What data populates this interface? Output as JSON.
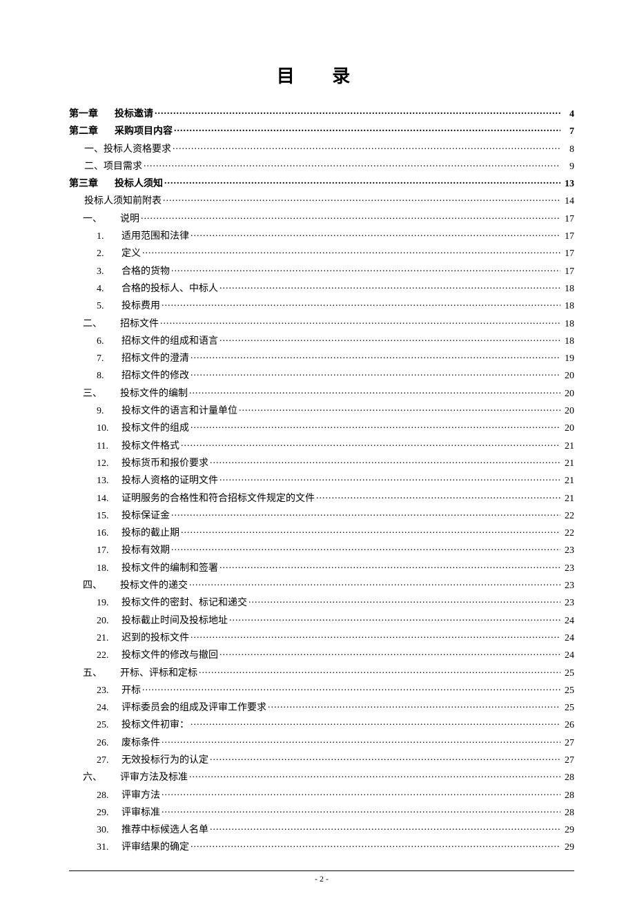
{
  "title": "目 录",
  "page_number_label": "- 2 -",
  "toc": [
    {
      "cls": "lv0 bold",
      "num": "第一章",
      "label": "投标邀请",
      "page": "4"
    },
    {
      "cls": "lv0 bold",
      "num": "第二章",
      "label": "采购项目内容",
      "page": "7"
    },
    {
      "cls": "lv1",
      "num": "",
      "label": "一、投标人资格要求",
      "page": "8"
    },
    {
      "cls": "lv1",
      "num": "",
      "label": "二、项目需求",
      "page": "9"
    },
    {
      "cls": "lv0 bold",
      "num": "第三章",
      "label": "投标人须知",
      "page": "13"
    },
    {
      "cls": "lv1",
      "num": "",
      "label": "投标人须知前附表",
      "page": "14"
    },
    {
      "cls": "lv1a",
      "num": "一、",
      "label": "说明",
      "page": "17"
    },
    {
      "cls": "lv2",
      "num": "1.",
      "label": "适用范围和法律",
      "page": "17"
    },
    {
      "cls": "lv2",
      "num": "2.",
      "label": "定义",
      "page": "17"
    },
    {
      "cls": "lv2",
      "num": "3.",
      "label": "合格的货物",
      "page": "17"
    },
    {
      "cls": "lv2",
      "num": "4.",
      "label": "合格的投标人、中标人",
      "page": "18"
    },
    {
      "cls": "lv2",
      "num": "5.",
      "label": "投标费用",
      "page": "18"
    },
    {
      "cls": "lv1a",
      "num": "二、",
      "label": "招标文件",
      "page": "18"
    },
    {
      "cls": "lv2",
      "num": "6.",
      "label": "招标文件的组成和语言",
      "page": "18"
    },
    {
      "cls": "lv2",
      "num": "7.",
      "label": "招标文件的澄清",
      "page": "19"
    },
    {
      "cls": "lv2",
      "num": "8.",
      "label": "招标文件的修改",
      "page": "20"
    },
    {
      "cls": "lv1a",
      "num": "三、",
      "label": "投标文件的编制",
      "page": "20"
    },
    {
      "cls": "lv2",
      "num": "9.",
      "label": "投标文件的语言和计量单位",
      "page": "20"
    },
    {
      "cls": "lv2",
      "num": "10.",
      "label": "  投标文件的组成",
      "page": "20"
    },
    {
      "cls": "lv2",
      "num": "11.",
      "label": "  投标文件格式",
      "page": "21"
    },
    {
      "cls": "lv2",
      "num": "12.",
      "label": "  投标货币和报价要求",
      "page": "21"
    },
    {
      "cls": "lv2",
      "num": "13.",
      "label": "  投标人资格的证明文件",
      "page": "21"
    },
    {
      "cls": "lv2",
      "num": "14.",
      "label": "  证明服务的合格性和符合招标文件规定的文件",
      "page": "21"
    },
    {
      "cls": "lv2",
      "num": "15.",
      "label": "  投标保证金",
      "page": "22"
    },
    {
      "cls": "lv2",
      "num": "16.",
      "label": "  投标的截止期",
      "page": "22"
    },
    {
      "cls": "lv2",
      "num": "17.",
      "label": "  投标有效期",
      "page": "23"
    },
    {
      "cls": "lv2",
      "num": "18.",
      "label": "  投标文件的编制和签署",
      "page": "23"
    },
    {
      "cls": "lv1a",
      "num": "四、",
      "label": "  投标文件的递交",
      "page": "23"
    },
    {
      "cls": "lv2",
      "num": "19.",
      "label": "  投标文件的密封、标记和递交",
      "page": "23"
    },
    {
      "cls": "lv2",
      "num": "20.",
      "label": "  投标截止时间及投标地址",
      "page": "24"
    },
    {
      "cls": "lv2",
      "num": "21.",
      "label": "  迟到的投标文件",
      "page": "24"
    },
    {
      "cls": "lv2",
      "num": "22.",
      "label": "  投标文件的修改与撤回",
      "page": "24"
    },
    {
      "cls": "lv1a",
      "num": "五、",
      "label": "开标、评标和定标",
      "page": "25"
    },
    {
      "cls": "lv2",
      "num": "23.",
      "label": "  开标",
      "page": "25"
    },
    {
      "cls": "lv2",
      "num": "24.",
      "label": "  评标委员会的组成及评审工作要求",
      "page": "25"
    },
    {
      "cls": "lv2",
      "num": "25.",
      "label": "  投标文件初审：",
      "page": "26"
    },
    {
      "cls": "lv2",
      "num": "26.",
      "label": "  废标条件",
      "page": "27"
    },
    {
      "cls": "lv2",
      "num": "27.",
      "label": "  无效投标行为的认定",
      "page": "27"
    },
    {
      "cls": "lv1a",
      "num": "六、",
      "label": "评审方法及标准",
      "page": "28"
    },
    {
      "cls": "lv2",
      "num": "28.",
      "label": "  评审方法",
      "page": "28"
    },
    {
      "cls": "lv2",
      "num": "29.",
      "label": "  评审标准",
      "page": "28"
    },
    {
      "cls": "lv2",
      "num": "30.",
      "label": "  推荐中标候选人名单",
      "page": "29"
    },
    {
      "cls": "lv2",
      "num": "31.",
      "label": "  评审结果的确定",
      "page": "29"
    }
  ]
}
